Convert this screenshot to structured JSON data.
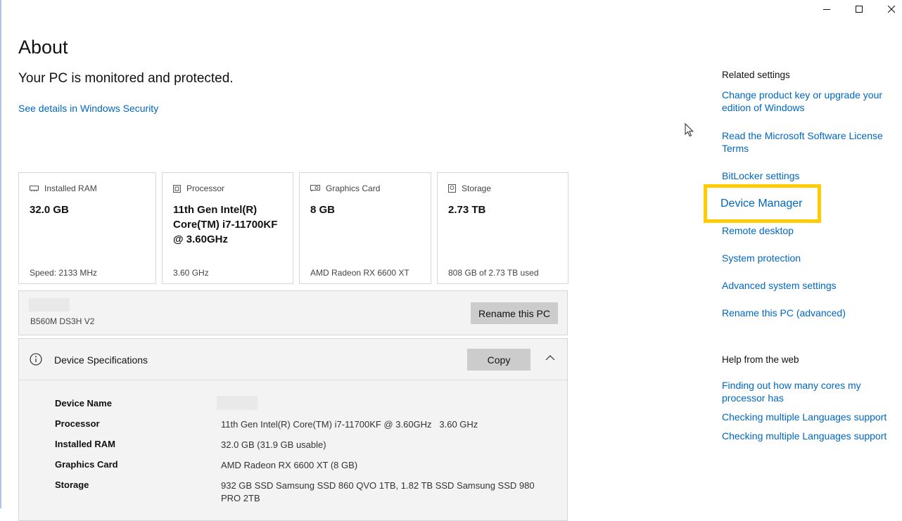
{
  "window": {
    "controls": [
      "minimize",
      "maximize",
      "close"
    ]
  },
  "page": {
    "title": "About",
    "protection_status": "Your PC is monitored and protected.",
    "security_link": "See details in Windows Security"
  },
  "cards": [
    {
      "label": "Installed RAM",
      "value": "32.0 GB",
      "sub": "Speed: 2133 MHz",
      "icon": "memory-icon"
    },
    {
      "label": "Processor",
      "value": "11th Gen Intel(R) Core(TM) i7-11700KF @ 3.60GHz",
      "sub": "3.60 GHz",
      "icon": "processor-icon"
    },
    {
      "label": "Graphics Card",
      "value": "8 GB",
      "sub": "AMD Radeon RX 6600 XT",
      "icon": "graphics-card-icon"
    },
    {
      "label": "Storage",
      "value": "2.73 TB",
      "sub": "808 GB of 2.73 TB used",
      "icon": "storage-icon"
    }
  ],
  "pc_name": {
    "model": "B560M DS3H V2",
    "rename_button": "Rename this PC"
  },
  "device_specs": {
    "header": "Device Specifications",
    "copy_button": "Copy",
    "rows": [
      {
        "key": "Device Name",
        "value": ""
      },
      {
        "key": "Processor",
        "value": "11th Gen Intel(R) Core(TM) i7-11700KF @ 3.60GHz   3.60 GHz"
      },
      {
        "key": "Installed RAM",
        "value": "32.0 GB (31.9 GB usable)"
      },
      {
        "key": "Graphics Card",
        "value": "AMD Radeon RX 6600 XT (8 GB)"
      },
      {
        "key": "Storage",
        "value": "932 GB SSD Samsung SSD 860 QVO 1TB, 1.82 TB SSD Samsung SSD 980 PRO 2TB"
      }
    ]
  },
  "related_settings": {
    "header": "Related settings",
    "links": [
      "Change product key or upgrade your edition of Windows",
      "Read the Microsoft Software License Terms",
      "BitLocker settings",
      "Device Manager",
      "Remote desktop",
      "System protection",
      "Advanced system settings",
      "Rename this PC (advanced)"
    ]
  },
  "help_from_web": {
    "header": "Help from the web",
    "links": [
      "Finding out how many cores my processor has",
      "Checking multiple Languages support",
      "Checking multiple Languages support"
    ]
  },
  "colors": {
    "link": "#0067c0",
    "highlight": "#ffcc00",
    "button": "#cccccc",
    "panel": "#f3f3f3"
  }
}
